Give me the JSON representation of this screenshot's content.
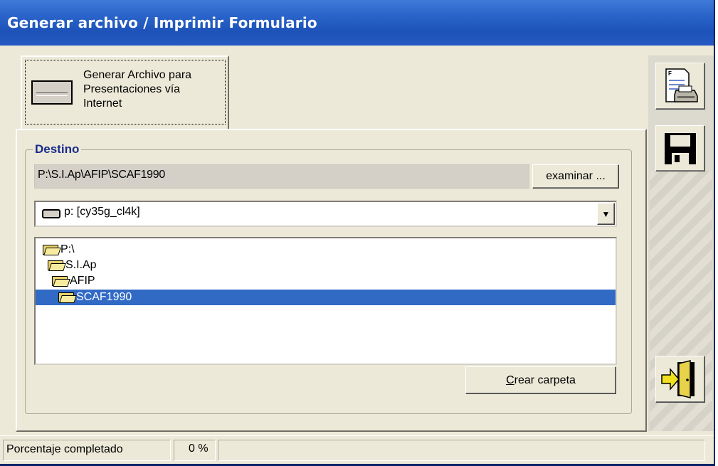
{
  "window": {
    "title": "Generar archivo / Imprimir Formulario"
  },
  "tab": {
    "label_line1": "Generar Archivo para",
    "label_line2": "Presentaciones vía",
    "label_line3": "Internet"
  },
  "destino": {
    "legend": "Destino",
    "path": "P:\\S.I.Ap\\AFIP\\SCAF1990",
    "browse_label": "examinar ...",
    "drive": "p: [cy35g_cl4k]",
    "folders": [
      {
        "name": "P:\\"
      },
      {
        "name": "S.I.Ap"
      },
      {
        "name": "AFIP"
      },
      {
        "name": "SCAF1990",
        "selected": true
      }
    ],
    "create_folder_label_underlined": "C",
    "create_folder_label_rest": "rear carpeta"
  },
  "toolbar": {
    "icons": [
      "print-form-icon",
      "save-disk-icon",
      "exit-door-icon"
    ]
  },
  "status": {
    "label": "Porcentaje completado",
    "value": "0 %"
  },
  "colors": {
    "titlebar": "#2a63c9",
    "selection": "#316ac5",
    "legend": "#1a2b8c"
  }
}
